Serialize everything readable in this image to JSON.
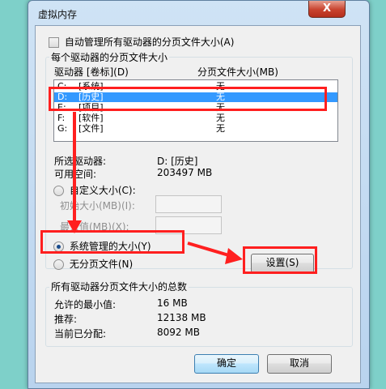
{
  "window": {
    "title": "虚拟内存",
    "close_label": "X"
  },
  "auto_manage": {
    "label": "自动管理所有驱动器的分页文件大小(A)",
    "checked": false
  },
  "per_drive": {
    "legend": "每个驱动器的分页文件大小",
    "columns": [
      "驱动器 [卷标](D)",
      "分页文件大小(MB)"
    ],
    "rows": [
      {
        "drive": "C:",
        "label": "[系统]",
        "size": "无",
        "selected": false
      },
      {
        "drive": "D:",
        "label": "[历史]",
        "size": "无",
        "selected": true
      },
      {
        "drive": "E:",
        "label": "[项目]",
        "size": "无",
        "selected": false
      },
      {
        "drive": "F:",
        "label": "[软件]",
        "size": "无",
        "selected": false
      },
      {
        "drive": "G:",
        "label": "[文件]",
        "size": "无",
        "selected": false
      }
    ],
    "selected_drive_label": "所选驱动器:",
    "selected_drive_value": "D:  [历史]",
    "free_space_label": "可用空间:",
    "free_space_value": "203497 MB",
    "custom_size_label": "自定义大小(C):",
    "initial_size_label": "初始大小(MB)(I):",
    "max_size_label": "最大值(MB)(X):",
    "system_managed_label": "系统管理的大小(Y)",
    "no_paging_label": "无分页文件(N)",
    "set_button": "设置(S)",
    "mode": "system_managed"
  },
  "totals": {
    "legend": "所有驱动器分页文件大小的总数",
    "min_label": "允许的最小值:",
    "min_value": "16 MB",
    "recommended_label": "推荐:",
    "recommended_value": "12138 MB",
    "current_label": "当前已分配:",
    "current_value": "8092 MB"
  },
  "buttons": {
    "ok": "确定",
    "cancel": "取消"
  },
  "colors": {
    "annotation": "#ff1f1f",
    "selection": "#3399ff"
  }
}
